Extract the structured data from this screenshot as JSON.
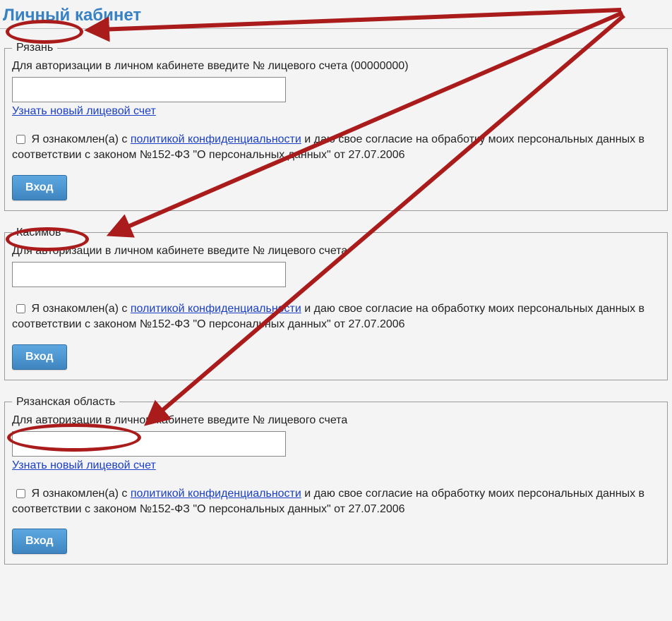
{
  "page_title": "Личный кабинет",
  "regions": [
    {
      "legend": "Рязань",
      "instruction": "Для авторизации в личном кабинете введите № лицевого счета (00000000)",
      "show_new_account_link": true,
      "new_account_link": "Узнать новый лицевой счет",
      "consent_prefix": "Я ознакомлен(а) с ",
      "policy_link": "политикой конфиденциальности",
      "consent_suffix": " и даю свое согласие на обработку моих персональных данных в соответствии с законом №152-ФЗ \"О персональных данных\" от 27.07.2006",
      "login_label": "Вход"
    },
    {
      "legend": "Касимов",
      "instruction": "Для авторизации в личном кабинете введите № лицевого счета",
      "show_new_account_link": false,
      "new_account_link": "",
      "consent_prefix": "Я ознакомлен(а) с ",
      "policy_link": "политикой конфиденциальности",
      "consent_suffix": " и даю свое согласие на обработку моих персональных данных в соответствии с законом №152-ФЗ \"О персональных данных\" от 27.07.2006",
      "login_label": "Вход"
    },
    {
      "legend": "Рязанская область",
      "instruction": "Для авторизации в личном кабинете введите № лицевого счета",
      "show_new_account_link": true,
      "new_account_link": "Узнать новый лицевой счет",
      "consent_prefix": "Я ознакомлен(а) с ",
      "policy_link": "политикой конфиденциальности",
      "consent_suffix": " и даю свое согласие на обработку моих персональных данных в соответствии с законом №152-ФЗ \"О персональных данных\" от 27.07.2006",
      "login_label": "Вход"
    }
  ]
}
